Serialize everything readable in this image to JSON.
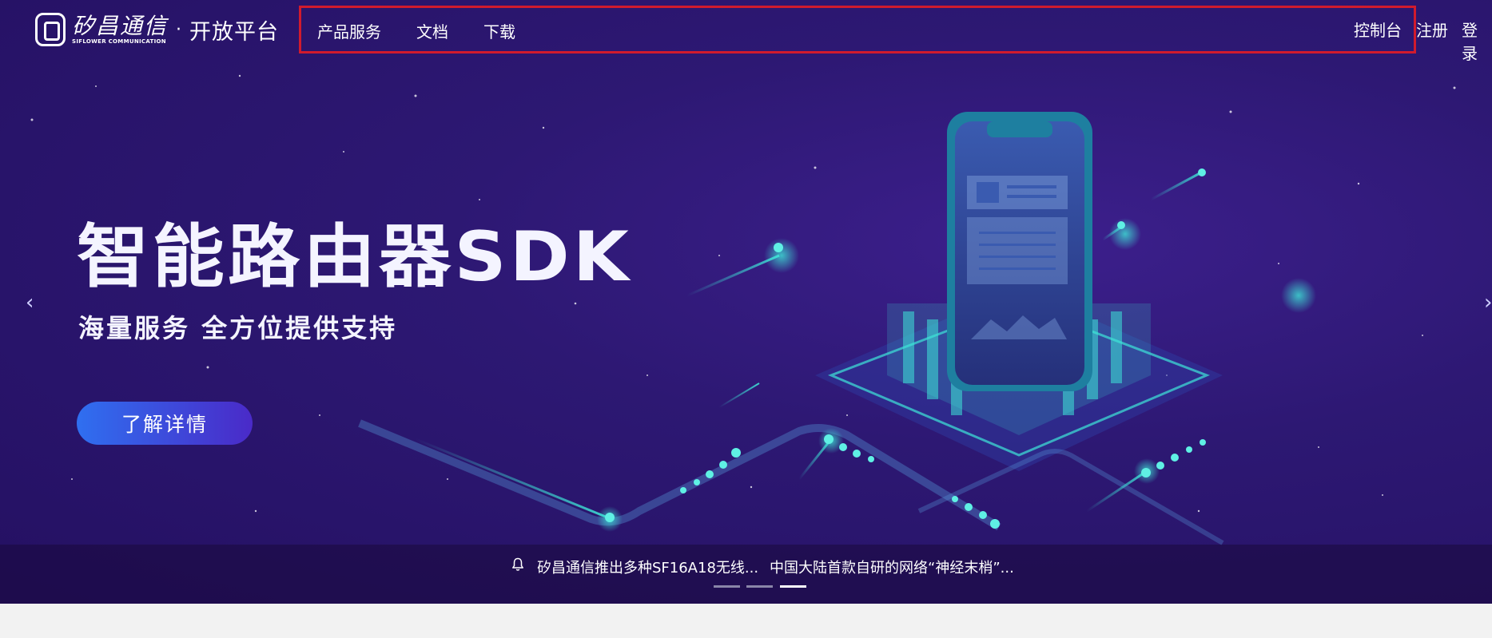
{
  "brand": {
    "logo_cn": "矽昌通信",
    "logo_en": "SIFLOWER COMMUNICATION",
    "separator": "·",
    "platform": "开放平台"
  },
  "nav": {
    "items": [
      {
        "label": "产品服务"
      },
      {
        "label": "文档"
      },
      {
        "label": "下载"
      }
    ],
    "right": {
      "console": "控制台",
      "register": "注册",
      "login": "登录"
    }
  },
  "banner": {
    "title": "智能路由器SDK",
    "subtitle": "海量服务 全方位提供支持",
    "cta": "了解详情",
    "prev_arrow": "‹",
    "next_arrow": "›"
  },
  "news": {
    "items": [
      {
        "text": "矽昌通信推出多种SF16A18无线..."
      },
      {
        "text": "中国大陆首款自研的网络“神经末梢”..."
      }
    ],
    "slides": 3,
    "active_slide": 3
  },
  "colors": {
    "nav_highlight_border": "#d11b2d",
    "cta_gradient_start": "#2f6ff0",
    "cta_gradient_end": "#4a2ac8",
    "hero_bg": "#2d1873",
    "accent_cyan": "#3ee6d8"
  },
  "icons": {
    "bell": "bell-icon",
    "prev": "chevron-left-icon",
    "next": "chevron-right-icon"
  }
}
